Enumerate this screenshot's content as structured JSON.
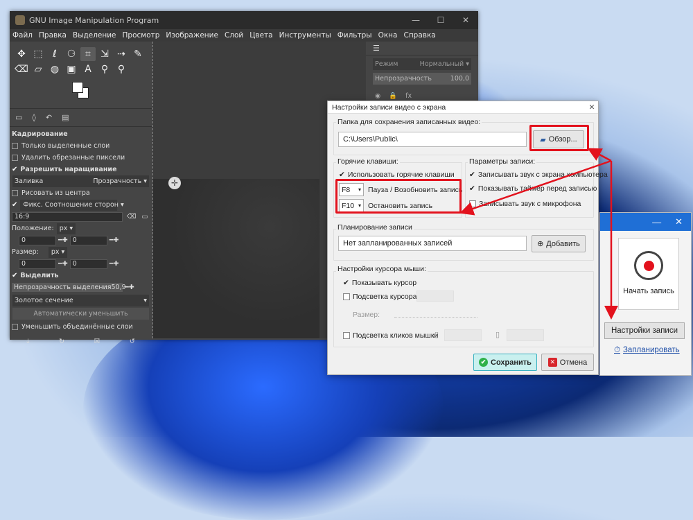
{
  "gimp": {
    "title": "GNU Image Manipulation Program",
    "win_minimize": "—",
    "win_maximize": "☐",
    "win_close": "✕",
    "menu": [
      "Файл",
      "Правка",
      "Выделение",
      "Просмотр",
      "Изображение",
      "Слой",
      "Цвета",
      "Инструменты",
      "Фильтры",
      "Окна",
      "Справка"
    ],
    "tools_row1": [
      "✥",
      "⬚",
      "ℓ",
      "⚆",
      "⌗",
      "⇲",
      "⇢",
      "✎"
    ],
    "tools_row2": [
      "⌫",
      "▱",
      "◍",
      "▣",
      "A",
      "⚲",
      "⚲",
      ""
    ],
    "tool_options": {
      "section": "Кадрирование",
      "only_selected_layers": "Только выделенные слои",
      "delete_cropped": "Удалить обрезанные пиксели",
      "allow_growing": "Разрешить наращивание",
      "fill_label": "Заливка",
      "fill_value": "Прозрачность",
      "draw_from_center": "Рисовать из центра",
      "fixed_label": "Фикс. Соотношение сторон",
      "ratio_value": "16:9",
      "position_label": "Положение:",
      "position_unit": "px",
      "pos_x": "0",
      "pos_y": "0",
      "size_label": "Размер:",
      "size_unit": "px",
      "size_w": "0",
      "size_h": "0",
      "highlight": "Выделить",
      "highlight_opacity_label": "Непрозрачность выделения",
      "highlight_opacity_value": "50,9",
      "guides": "Золотое сечение",
      "auto_shrink": "Автоматически уменьшить",
      "shrink_merged": "Уменьшить объединённые слои"
    },
    "layers": {
      "mode_label": "Режим",
      "mode_value": "Нормальный",
      "opacity_label": "Непрозрачность",
      "opacity_value": "100,0"
    }
  },
  "dialog": {
    "title": "Настройки записи видео с экрана",
    "folder_label": "Папка для сохранения записанных видео:",
    "folder_value": "C:\\Users\\Public\\",
    "browse_button": "Обзор...",
    "hotkeys_group": "Горячие клавиши:",
    "use_hotkeys": "Использовать горячие клавиши",
    "hotkey_pause_key": "F8",
    "hotkey_pause_label": "Пауза / Возобновить запись",
    "hotkey_stop_key": "F10",
    "hotkey_stop_label": "Остановить запись",
    "record_params_group": "Параметры записи:",
    "rec_system_sound": "Записывать звук с экрана компьютера",
    "show_timer": "Показывать таймер перед записью",
    "rec_mic": "Записывать звук с микрофона",
    "schedule_group": "Планирование записи",
    "schedule_value": "Нет запланированных записей",
    "add_button": "Добавить",
    "cursor_group": "Настройки курсора мыши:",
    "show_cursor": "Показывать курсор",
    "cursor_highlight": "Подсветка курсора",
    "size_label": "Размер:",
    "click_highlight": "Подсветка кликов мышки",
    "save_button": "Сохранить",
    "cancel_button": "Отмена"
  },
  "recorder": {
    "minimize": "—",
    "close": "✕",
    "start_label": "Начать запись",
    "settings_button": "Настройки записи",
    "schedule_link": "Запланировать"
  },
  "colors": {
    "highlight_red": "#e3121d",
    "recorder_title": "#1f6fd6"
  }
}
